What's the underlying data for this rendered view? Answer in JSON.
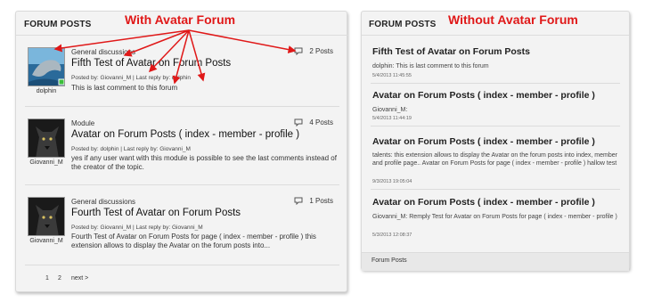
{
  "annotations": {
    "with_avatar": "With Avatar Forum",
    "without_avatar": "Without Avatar Forum"
  },
  "left_panel": {
    "title": "FORUM POSTS",
    "posts": [
      {
        "category": "General discussions",
        "title": "Fifth Test of Avatar on Forum Posts",
        "meta": "Posted by: Giovanni_M | Last reply by: dolphin",
        "excerpt": "This is last comment to this forum",
        "count": "2 Posts",
        "author": "dolphin"
      },
      {
        "category": "Module",
        "title": "Avatar on Forum Posts ( index - member - profile )",
        "meta": "Posted by: dolphin | Last reply by: Giovanni_M",
        "excerpt": "yes if any user want with this module is possible to see the last comments instead of the creator of the topic.",
        "count": "4 Posts",
        "author": "Giovanni_M"
      },
      {
        "category": "General discussions",
        "title": "Fourth Test of Avatar on Forum Posts",
        "meta": "Posted by: Giovanni_M | Last reply by: Giovanni_M",
        "excerpt": "Fourth Test of Avatar on Forum Posts for page ( index - member - profile ) this extension allows to display the Avatar on the forum posts into...",
        "count": "1 Posts",
        "author": "Giovanni_M"
      }
    ],
    "pagination": {
      "page1": "1",
      "page2": "2",
      "next": "next >"
    }
  },
  "right_panel": {
    "title": "FORUM POSTS",
    "posts": [
      {
        "title": "Fifth Test of Avatar on Forum Posts",
        "text": "dolphin: This is last comment to this forum",
        "date": "5/4/2013 11:45:55"
      },
      {
        "title": "Avatar on Forum Posts ( index - member - profile )",
        "text": "Giovanni_M:",
        "date": "5/4/2013 11:44:19"
      },
      {
        "title": "Avatar on Forum Posts ( index - member - profile )",
        "text": "talents: this extension allows to display the Avatar on the forum posts into index, member and profile page.. Avatar on Forum Posts for page ( index - member - profile ) hallow test",
        "date": "9/3/2013 19:05:04"
      },
      {
        "title": "Avatar on Forum Posts ( index - member - profile )",
        "text": "Giovanni_M: Remply Test for Avatar on Forum Posts for page ( index - member - profile )",
        "date": "5/3/2013 12:08:37"
      }
    ],
    "footer": "Forum Posts"
  },
  "colors": {
    "annotation": "#e01818",
    "online": "#3bbf3b"
  }
}
